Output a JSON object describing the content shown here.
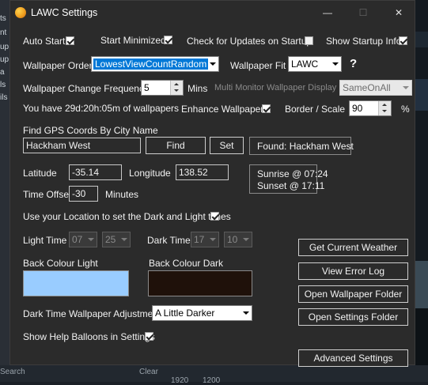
{
  "window": {
    "title": "LAWC Settings"
  },
  "titlebar": {
    "minimize": "—",
    "maximize": "☐",
    "close": "✕"
  },
  "options_row": {
    "auto_start": {
      "label": "Auto Start",
      "checked": true
    },
    "start_minimized": {
      "label": "Start Minimized",
      "checked": true
    },
    "check_updates": {
      "label": "Check for Updates on Startup",
      "checked": false
    },
    "show_startup_info": {
      "label": "Show Startup Info",
      "checked": true
    }
  },
  "wallpaper": {
    "order_label": "Wallpaper Order",
    "order_value": "LowestViewCountRandom",
    "fit_label": "Wallpaper Fit",
    "fit_value": "LAWC",
    "help": "?",
    "change_freq_label": "Wallpaper Change Frequency",
    "change_freq_value": "5",
    "mins_label": "Mins",
    "multi_monitor_label": "Multi Monitor Wallpaper Display",
    "multi_monitor_value": "SameOnAll",
    "remaining_text": "You have 29d:20h:05m of wallpapers",
    "enhance_label": "Enhance Wallpaper",
    "enhance_checked": true,
    "border_scale_label": "Border / Scale",
    "border_scale_value": "90",
    "percent": "%"
  },
  "gps": {
    "find_label": "Find GPS Coords By City Name",
    "city_value": "Hackham West",
    "find_button": "Find",
    "set_button": "Set",
    "found_text": "Found: Hackham West",
    "latitude_label": "Latitude",
    "latitude_value": "-35.14",
    "longitude_label": "Longitude",
    "longitude_value": "138.52",
    "time_offset_label": "Time Offset",
    "time_offset_value": "-30",
    "minutes_label": "Minutes",
    "sunrise": "Sunrise @ 07:24",
    "sunset": "Sunset @ 17:11",
    "use_location_label": "Use your Location to set the Dark and Light times",
    "use_location_checked": true
  },
  "times": {
    "light_label": "Light Time",
    "light_hour": "07",
    "light_min": "25",
    "dark_label": "Dark Time",
    "dark_hour": "17",
    "dark_min": "10"
  },
  "colours": {
    "light_label": "Back Colour Light",
    "light_color": "#99ccff",
    "dark_label": "Back Colour Dark",
    "dark_color": "#1f110a"
  },
  "dark_adjust": {
    "label": "Dark Time Wallpaper Adjustment",
    "value": "A Little Darker"
  },
  "help_balloons": {
    "label": "Show Help Balloons in Settings",
    "checked": true
  },
  "buttons": {
    "weather": "Get Current Weather",
    "error_log": "View Error Log",
    "wallpaper_folder": "Open Wallpaper Folder",
    "settings_folder": "Open Settings Folder",
    "advanced": "Advanced Settings"
  },
  "background": {
    "left_fragments": [
      "ts",
      "nt",
      "up",
      "up",
      "a",
      "ls",
      "ils"
    ],
    "bottom_fragments": [
      "Search",
      "Clear",
      "1920",
      "1200"
    ]
  }
}
